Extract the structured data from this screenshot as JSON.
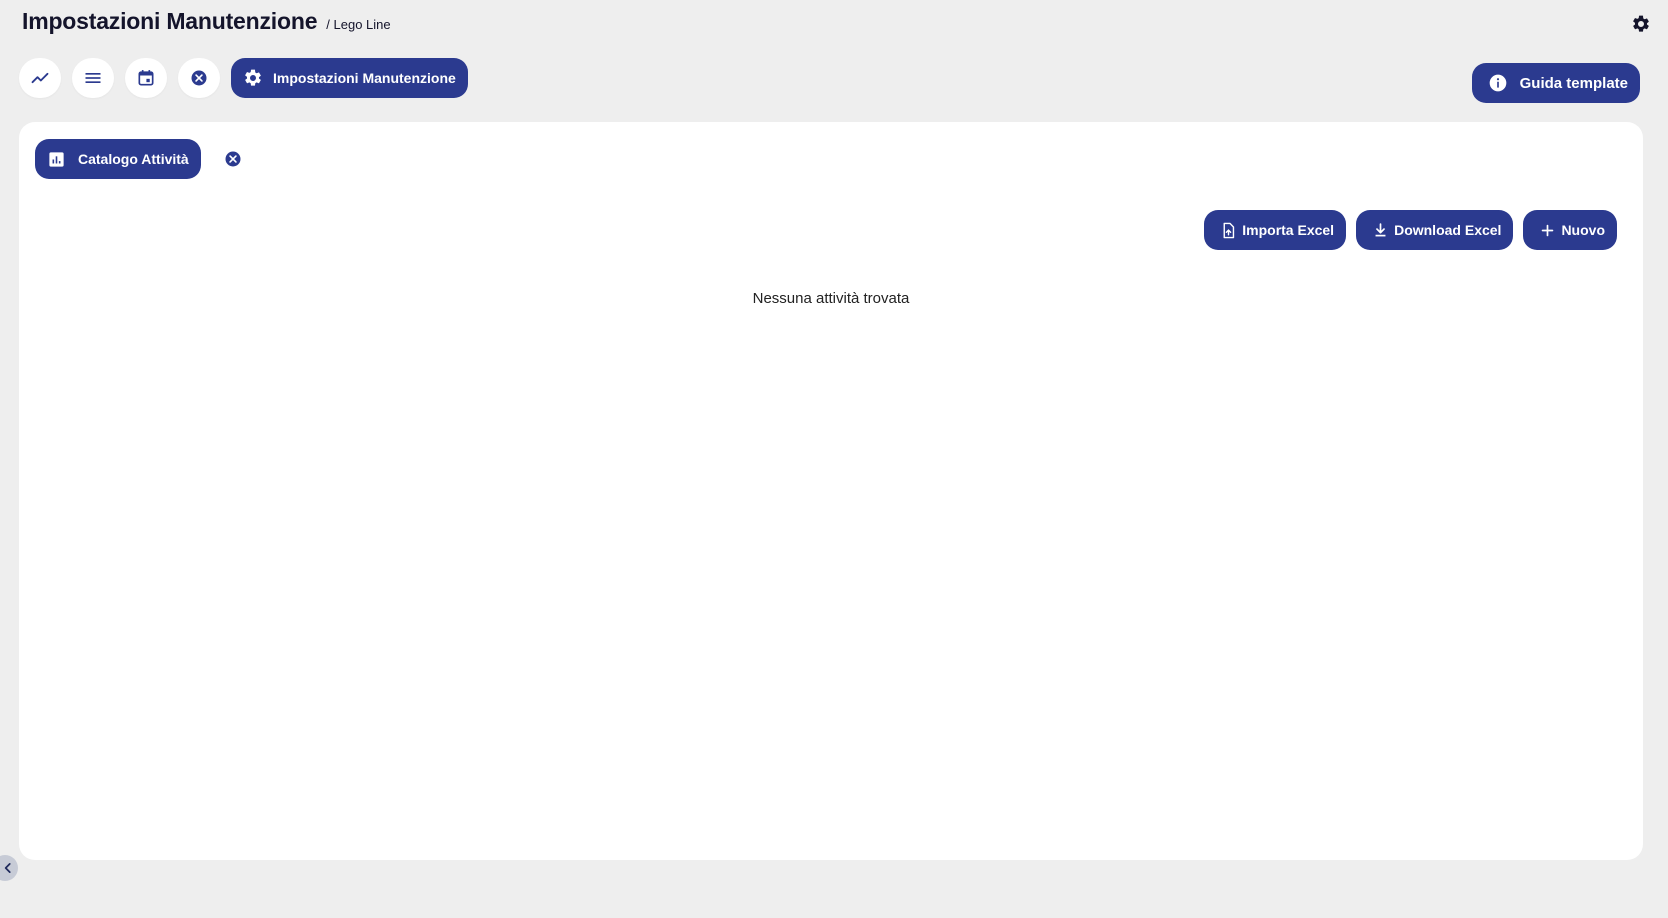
{
  "header": {
    "title": "Impostazioni Manutenzione",
    "subtitle": "/ Lego Line"
  },
  "toolbar": {
    "icons": [
      "trend-icon",
      "list-icon",
      "calendar-icon",
      "close-circle-icon"
    ],
    "active_label": "Impostazioni Manutenzione"
  },
  "guide_button": {
    "label": "Guida template"
  },
  "card": {
    "tab_label": "Catalogo Attività",
    "actions": {
      "import_label": "Importa Excel",
      "download_label": "Download Excel",
      "new_label": "Nuovo"
    },
    "empty_text": "Nessuna attività trovata"
  },
  "colors": {
    "primary": "#2b3a8f",
    "background": "#eeeeee",
    "card": "#ffffff"
  }
}
